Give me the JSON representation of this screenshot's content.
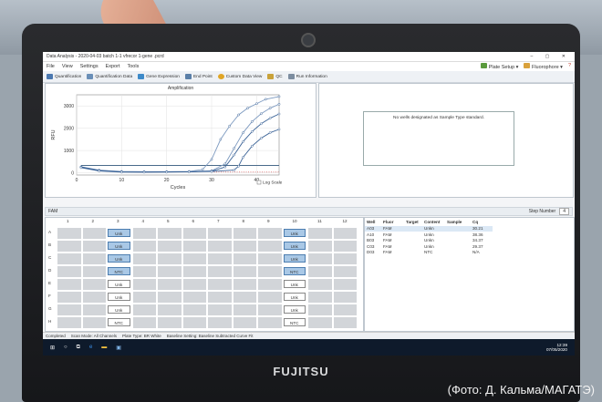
{
  "photo_caption": "(Фото: Д. Кальма/МАГАТЭ)",
  "laptop_brand": "FUJITSU",
  "window_title": "Data Analysis - 2020-04-03 batch 1-1 vfrecor 1-gene .pcrd",
  "menu": {
    "items": [
      "File",
      "View",
      "Settings",
      "Export",
      "Tools"
    ],
    "plate_setup": "Plate Setup",
    "fluorophore": "Fluorophore"
  },
  "toolbar": [
    "Quantification",
    "Quantification Data",
    "Gene Expression",
    "End Point",
    "Custom Data View",
    "QC",
    "Run Information"
  ],
  "chart_data": {
    "type": "line",
    "title": "Amplification",
    "xlabel": "Cycles",
    "ylabel": "RFU",
    "xlim": [
      0,
      45
    ],
    "ylim": [
      -100,
      3500
    ],
    "x_ticks": [
      0,
      10,
      20,
      30,
      40
    ],
    "y_ticks": [
      0,
      1000,
      2000,
      3000
    ],
    "threshold": 330,
    "series": [
      {
        "x": [
          1,
          5,
          10,
          15,
          20,
          25,
          28,
          30,
          32,
          34,
          36,
          38,
          40,
          42,
          45
        ],
        "y": [
          270,
          120,
          60,
          50,
          50,
          60,
          150,
          600,
          1500,
          2100,
          2600,
          2900,
          3100,
          3300,
          3420
        ]
      },
      {
        "x": [
          1,
          5,
          10,
          15,
          20,
          25,
          30,
          33,
          35,
          37,
          39,
          41,
          43,
          45
        ],
        "y": [
          250,
          110,
          50,
          40,
          45,
          50,
          90,
          400,
          1100,
          1800,
          2300,
          2650,
          2900,
          3080
        ]
      },
      {
        "x": [
          1,
          5,
          10,
          15,
          20,
          25,
          30,
          33,
          35,
          37,
          39,
          41,
          43,
          45
        ],
        "y": [
          260,
          100,
          40,
          35,
          40,
          45,
          70,
          260,
          800,
          1400,
          1850,
          2200,
          2450,
          2640
        ]
      },
      {
        "x": [
          1,
          5,
          10,
          15,
          20,
          25,
          30,
          35,
          36,
          37,
          39,
          41,
          43,
          45
        ],
        "y": [
          230,
          80,
          30,
          25,
          30,
          40,
          60,
          120,
          300,
          700,
          1200,
          1550,
          1800,
          1950
        ]
      }
    ],
    "log_scale_label": "Log Scale"
  },
  "message": "No wells designated as Sample Type standard.",
  "fluor_label": "FAM",
  "step_label": "Step Number",
  "step_value": "4",
  "plate": {
    "columns": [
      "1",
      "2",
      "3",
      "4",
      "5",
      "6",
      "7",
      "8",
      "9",
      "10",
      "11",
      "12"
    ],
    "rows": [
      "A",
      "B",
      "C",
      "D",
      "E",
      "F",
      "G",
      "H"
    ],
    "col3": [
      "Unk",
      "Unk",
      "Unk",
      "NTC",
      "Unk",
      "Unk",
      "Unk",
      "NTC"
    ],
    "col10": [
      "Unk",
      "Unk",
      "Unk",
      "NTC",
      "Unk",
      "Unk",
      "Unk",
      "NTC"
    ]
  },
  "table": {
    "headers": [
      "Well",
      "Fluor",
      "Target",
      "Content",
      "Sample",
      "Cq"
    ],
    "rows": [
      [
        "A03",
        "FAM",
        "",
        "Unkn",
        "",
        "30.21"
      ],
      [
        "A10",
        "FAM",
        "",
        "Unkn",
        "",
        "38.36"
      ],
      [
        "B03",
        "FAM",
        "",
        "Unkn",
        "",
        "34.37"
      ],
      [
        "C03",
        "FAM",
        "",
        "Unkn",
        "",
        "29.37"
      ],
      [
        "D03",
        "FAM",
        "",
        "NTC",
        "",
        "N/A"
      ]
    ]
  },
  "status": [
    "Completed",
    "Scan Mode: All Channels",
    "Plate Type: BR White",
    "Baseline Setting: Baseline Subtracted Curve Fit"
  ],
  "clock": {
    "time": "12:39",
    "date": "07/05/2020"
  }
}
